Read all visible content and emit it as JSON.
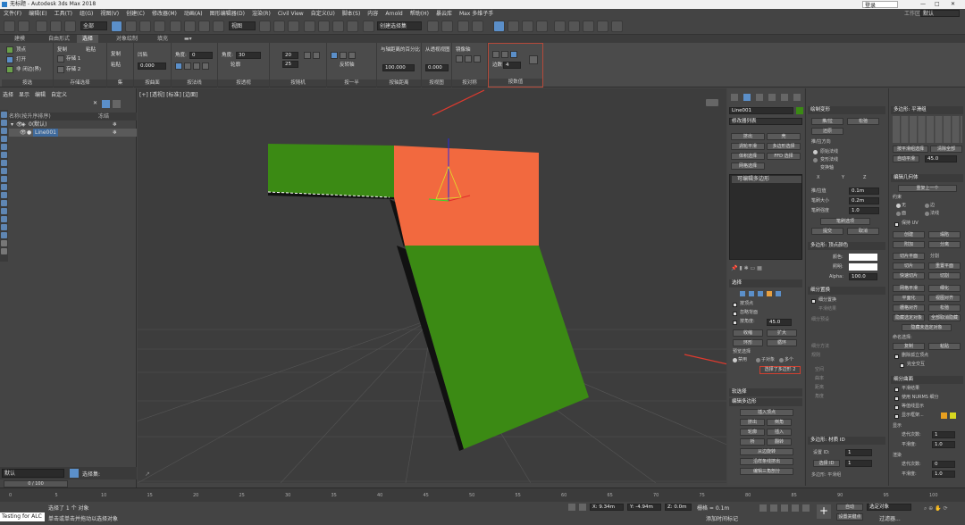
{
  "titlebar": {
    "title": "无标题 - Autodesk 3ds Max 2018",
    "right": "登录",
    "workspace_label": "工作区:",
    "workspace": "默认"
  },
  "menu": [
    "文件(F)",
    "编辑(E)",
    "工具(T)",
    "组(G)",
    "视图(V)",
    "创建(C)",
    "修改器(M)",
    "动画(A)",
    "图形编辑器(D)",
    "渲染(R)",
    "Civil View",
    "自定义(U)",
    "脚本(S)",
    "内容",
    "Arnold",
    "帮助(H)",
    "暴云库",
    "Max 多维子手"
  ],
  "toolbar": {
    "view_dropdown": "视图",
    "selection_set": "创建选择集"
  },
  "ribbon_tabs": [
    "建模",
    "自由形式",
    "选择",
    "对象绘制",
    "填充"
  ],
  "ribbon_active_tab": "选择",
  "ribbon_groups": {
    "select_by": {
      "items": [
        "顶点",
        "打开",
        "非 闭边(界)"
      ],
      "label": "按选"
    },
    "stored_sel": {
      "items": [
        "复制",
        "存储 1",
        "粘贴",
        "存储 2"
      ],
      "label": "存储选择"
    },
    "set": {
      "items": [
        "复制",
        "粘贴"
      ],
      "label": "集"
    },
    "by_surface": {
      "items": [
        "凹陷",
        "凸起"
      ],
      "value": "0.000",
      "label": "按曲面"
    },
    "by_normal": {
      "angle_label": "角度:",
      "angle": "0",
      "label": "按法线"
    },
    "by_perspective": {
      "angle_label": "角度:",
      "angle": "30",
      "invert": "轮廓",
      "label": "按透视"
    },
    "random": {
      "v1": "20",
      "v2": "25",
      "label": "按随机"
    },
    "half": {
      "item": "反转轴",
      "label": "按一半"
    },
    "pivot_dist": {
      "item": "与轴距离的百分比",
      "value": "100.000",
      "label": "按轴距离"
    },
    "view": {
      "item": "从透视视图",
      "value": "0.000",
      "label": "按视图"
    },
    "symmetry": {
      "item": "镜像轴",
      "label": "按对称"
    },
    "numeric": {
      "item": "边数",
      "value": "4",
      "label": "按数值"
    }
  },
  "scene_explorer": {
    "menu": [
      "选择",
      "显示",
      "编辑",
      "自定义"
    ],
    "header": "名称(按升序排序)",
    "header_right": "冻结",
    "rows": [
      {
        "name": "0(默认)"
      },
      {
        "name": "Line001"
      }
    ],
    "layer": "默认",
    "selection_label": "选择集:"
  },
  "viewport": {
    "label": "[+] [透视] [标准] [边面]"
  },
  "command_panel": {
    "object_name": "Line001",
    "modifier_list": "修改器列表",
    "buttons": [
      "挤出",
      "壳",
      "涡轮平滑",
      "多边形选择",
      "体积选择",
      "FFD 选择",
      "网格选择"
    ],
    "stack_item": "可编辑多边形",
    "rollouts": {
      "selection": "选择",
      "soft_sel": "软选择",
      "edit_poly": "编辑多边形"
    },
    "selection_checks": [
      "按顶点",
      "忽略背面",
      "按角度:"
    ],
    "angle_value": "45.0",
    "sel_buttons": [
      "收缩",
      "扩大",
      "环形",
      "循环"
    ],
    "preview_label": "预览选择",
    "preview_opts": [
      "禁用",
      "子对象",
      "多个"
    ],
    "selected_info": "选择了多边形 2",
    "edit_poly_buttons": [
      "插入顶点",
      "挤出",
      "轮廓",
      "倒角",
      "插入",
      "桥",
      "翻转",
      "从边旋转",
      "沿样条线挤出",
      "编辑三角剖分"
    ]
  },
  "panel2": {
    "paint_deform": "绘制变形",
    "paint_buttons": [
      "推/拉",
      "松弛",
      "还原"
    ],
    "push_pull": "推/拉方向",
    "radio": [
      "原始法线",
      "变形法线",
      "变换轴"
    ],
    "axes": [
      "X",
      "Y",
      "Z"
    ],
    "params": [
      {
        "label": "推/拉值",
        "value": "0.1m"
      },
      {
        "label": "笔刷大小",
        "value": "0.2m"
      },
      {
        "label": "笔刷强度",
        "value": "1.0"
      }
    ],
    "brush_options": "笔刷选项",
    "commit": "提交",
    "cancel": "取消",
    "poly_material": "多边形: 材质 ID",
    "set_id_label": "设置 ID:",
    "set_id": "1",
    "select_id_label": "选择 ID",
    "select_id": "1",
    "smoothing": "多边形: 平滑组",
    "color_rollout": "多边形: 顶点颜色",
    "color_labels": [
      "颜色:",
      "照明:"
    ],
    "alpha_label": "Alpha:",
    "alpha": "100.0",
    "subdiv": "细分置换",
    "subdiv_items": [
      "细分置换",
      "平滑结果",
      "细分预设",
      "细分方法",
      "规则",
      "空间",
      "曲率",
      "距离",
      "角度"
    ]
  },
  "panel3": {
    "poly_header": "多边形: 平滑组",
    "select_smooth": "按平滑组选择",
    "clear_all": "清除全部",
    "auto_smooth": "自动平滑",
    "auto_value": "45.0",
    "edit_geom": "编辑几何体",
    "repeat_last": "重复上一个",
    "constraints": "约束",
    "constraint_opts": [
      "无",
      "边",
      "面",
      "法线"
    ],
    "preserve_uv": "保持 UV",
    "geom_buttons": [
      "创建",
      "塌陷",
      "附加",
      "分离",
      "切片平面",
      "分割",
      "切片",
      "重置平面",
      "快速切片",
      "切割",
      "网格平滑",
      "细化",
      "平面化",
      "视图对齐",
      "栅格对齐",
      "松弛",
      "隐藏选定对象",
      "全部取消隐藏",
      "隐藏未选定对象"
    ],
    "named_sel": "命名选择:",
    "copy": "复制",
    "paste": "粘贴",
    "delete_iso": "删除孤立顶点",
    "full_interactive": "完全交互",
    "subdivision": "细分曲面",
    "sub_items": [
      "平滑结果",
      "使用 NURMS 细分",
      "等值线显示",
      "显示框架...",
      "显示",
      "迭代次数:",
      "平滑度:",
      "渲染",
      "迭代次数:",
      "平滑度:"
    ],
    "iter_values": [
      "1",
      "1.0",
      "0",
      "1.0"
    ]
  },
  "timeline": {
    "frame": "0 / 100",
    "ticks": [
      "0",
      "5",
      "10",
      "15",
      "20",
      "25",
      "30",
      "35",
      "40",
      "45",
      "50",
      "55",
      "60",
      "65",
      "70",
      "75",
      "80",
      "85",
      "90",
      "95",
      "100"
    ]
  },
  "status": {
    "script_label": "Testing for ALC",
    "line1": "选择了 1 个 对象",
    "line2": "单击或单击并拖动以选择对象",
    "coord_x": "X: 9.34m",
    "coord_y": "Y: -4.94m",
    "coord_z": "Z: 0.0m",
    "grid": "栅格 = 0.1m",
    "add_time_tag": "添加时间标记",
    "auto": "自动",
    "set_key": "设置关键点",
    "selected": "选定对象",
    "key_filters": "过滤器..."
  },
  "colors": {
    "green_face": "#3b8a14",
    "orange_face": "#f2693f",
    "accent": "#5b8fc9",
    "arrow": "#e03a2e"
  }
}
